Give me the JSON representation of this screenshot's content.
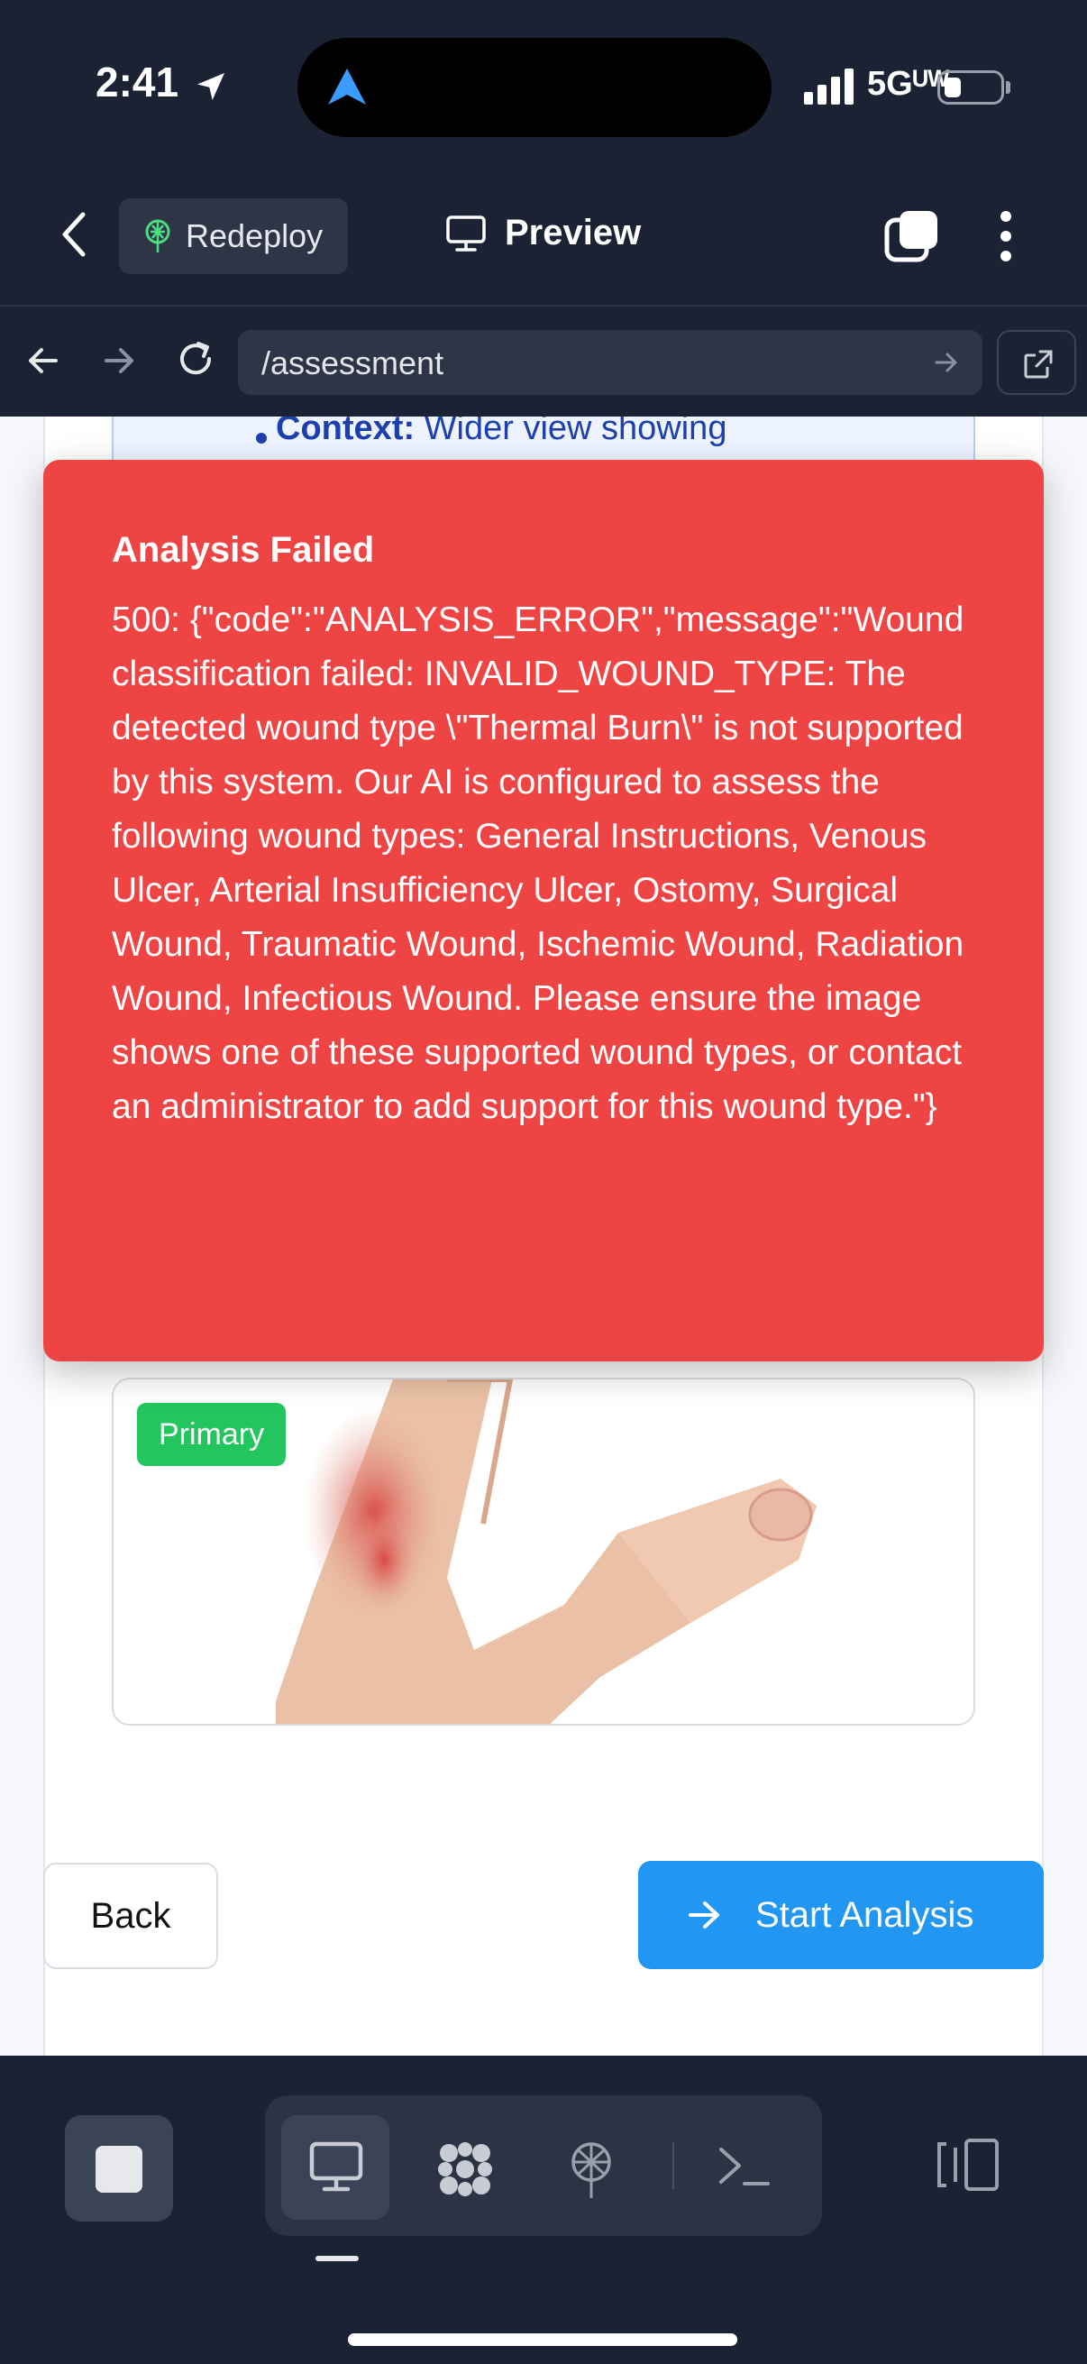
{
  "status_bar": {
    "time": "2:41",
    "network": "5Gᵁᵂ",
    "icons": [
      "location-arrow-icon",
      "signal-bars-icon",
      "battery-icon"
    ]
  },
  "toolbar": {
    "redeploy_label": "Redeploy",
    "preview_label": "Preview",
    "icons": [
      "chevron-left-icon",
      "redeploy-icon",
      "monitor-icon",
      "windows-icon",
      "more-vertical-icon"
    ]
  },
  "browser": {
    "url": "/assessment",
    "icons": [
      "arrow-left-icon",
      "arrow-right-icon",
      "reload-icon",
      "go-arrow-icon",
      "open-external-icon"
    ]
  },
  "guide": {
    "context_label": "Context:",
    "context_text": " Wider view showing"
  },
  "image_card": {
    "badge": "Primary"
  },
  "actions": {
    "back_label": "Back",
    "start_label": "Start Analysis"
  },
  "toast": {
    "title": "Analysis Failed",
    "message": "500: {\"code\":\"ANALYSIS_ERROR\",\"message\":\"Wound classification failed: INVALID_WOUND_TYPE: The detected wound type \\\"Thermal Burn\\\" is not supported by this system. Our AI is configured to assess the following wound types: General Instructions, Venous Ulcer, Arterial Insufficiency Ulcer, Ostomy, Surgical Wound, Traumatic Wound, Ischemic Wound, Radiation Wound, Infectious Wound. Please ensure the image shows one of these supported wound types, or contact an administrator to add support for this wound type.\"}"
  },
  "bottom_bar": {
    "icons": [
      "stop-icon",
      "desktop-icon",
      "apps-grid-icon",
      "deploy-icon",
      "terminal-icon",
      "side-panel-icon"
    ]
  },
  "colors": {
    "chrome_bg": "#1b2233",
    "error": "#ef4444",
    "primary_blue": "#2196f3",
    "success_green": "#22c55e"
  }
}
